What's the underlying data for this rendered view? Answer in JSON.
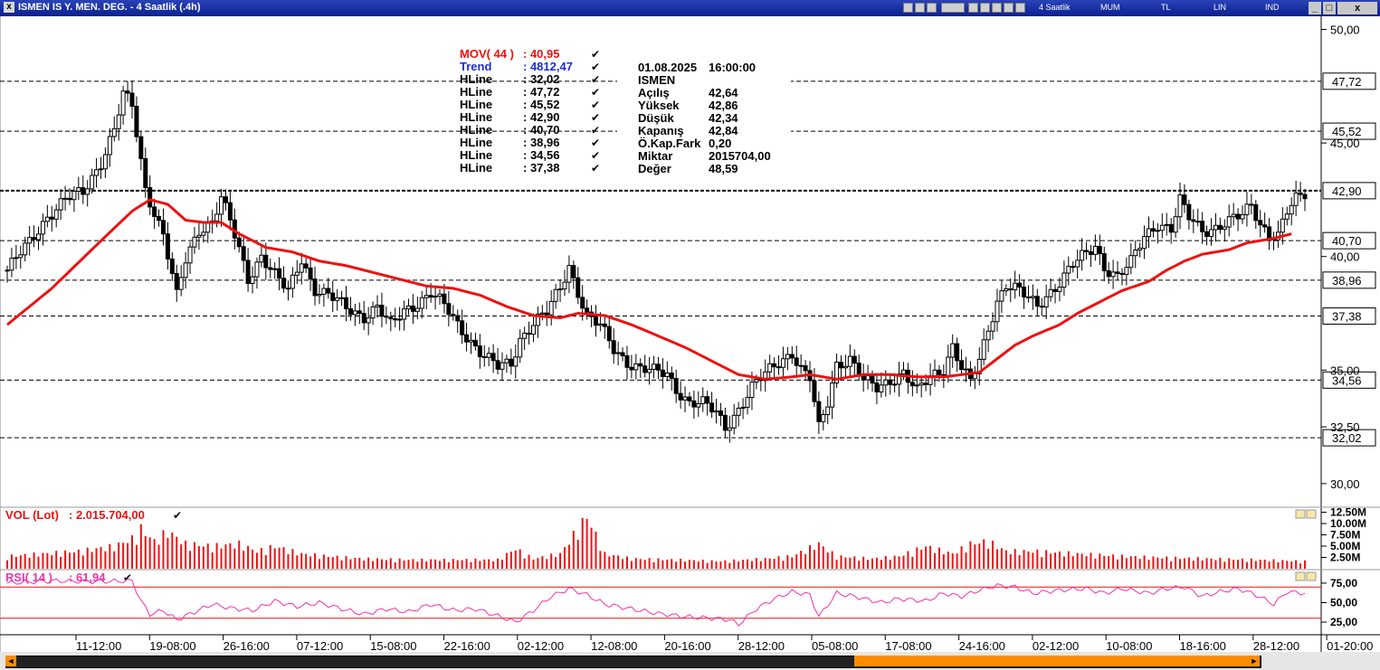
{
  "window": {
    "title": "ISMEN IS Y. MEN. DEG. - 4 Saatlik (.4h)",
    "toolbar_items": [
      "4 Saatlik",
      "MUM",
      "TL",
      "LIN",
      "IND"
    ],
    "close_glyph": "x"
  },
  "colors": {
    "mov": "#ee1111",
    "trend": "#1a2fd8",
    "vol": "#ee1111",
    "rsi": "#ee33aa",
    "rsi_band": "#ee1111",
    "candle": "#000000",
    "scroll_thumb": "#ff8c00"
  },
  "legend": {
    "indicators": [
      {
        "label": "MOV( 44 )",
        "value": ": 40,95",
        "color": "#ee1111"
      },
      {
        "label": "Trend",
        "value": ": 4812,47",
        "color": "#1a2fd8"
      },
      {
        "label": "HLine",
        "value": ": 32,02",
        "color": "#000000"
      },
      {
        "label": "HLine",
        "value": ": 47,72",
        "color": "#000000"
      },
      {
        "label": "HLine",
        "value": ": 45,52",
        "color": "#000000"
      },
      {
        "label": "HLine",
        "value": ": 42,90",
        "color": "#000000"
      },
      {
        "label": "HLine",
        "value": ": 40,70",
        "color": "#000000"
      },
      {
        "label": "HLine",
        "value": ": 38,96",
        "color": "#000000"
      },
      {
        "label": "HLine",
        "value": ": 34,56",
        "color": "#000000"
      },
      {
        "label": "HLine",
        "value": ": 37,38",
        "color": "#000000"
      }
    ],
    "check_glyph": "✔"
  },
  "info_box": {
    "datetime": [
      "01.08.2025",
      "16:00:00"
    ],
    "symbol": "ISMEN",
    "rows": [
      {
        "k": "Açılış",
        "v": "42,64"
      },
      {
        "k": "Yüksek",
        "v": "42,86"
      },
      {
        "k": "Düşük",
        "v": "42,34"
      },
      {
        "k": "Kapanış",
        "v": "42,84"
      },
      {
        "k": "Ö.Kap.Fark",
        "v": "0,20"
      },
      {
        "k": "Miktar",
        "v": "2015704,00"
      },
      {
        "k": "Değer",
        "v": "48,59"
      }
    ]
  },
  "vol_panel": {
    "label": "VOL (Lot)",
    "value": ": 2.015.704,00",
    "ticks": [
      "12.50M",
      "10.00M",
      "7.50M",
      "5.00M",
      "2.50M"
    ]
  },
  "rsi_panel": {
    "label": "RSI( 14 )",
    "value": ": 61,94",
    "ticks": [
      "75,00",
      "50,00",
      "25,00"
    ],
    "bands": [
      70,
      30
    ]
  },
  "chart_data": {
    "type": "candlestick",
    "price_axis": {
      "min": 29.0,
      "max": 50.5,
      "ticks": [
        "50,00",
        "45,00",
        "40,00",
        "35,00",
        "32,50",
        "30,00"
      ]
    },
    "hlines": [
      {
        "value": 47.72,
        "label": "47,72"
      },
      {
        "value": 45.52,
        "label": "45,52"
      },
      {
        "value": 42.9,
        "label": "42,90"
      },
      {
        "value": 40.7,
        "label": "40,70"
      },
      {
        "value": 38.96,
        "label": "38,96"
      },
      {
        "value": 37.38,
        "label": "37,38"
      },
      {
        "value": 34.56,
        "label": "34,56"
      },
      {
        "value": 32.02,
        "label": "32,02"
      }
    ],
    "x_labels": [
      "11-12:00",
      "19-08:00",
      "26-16:00",
      "07-12:00",
      "15-08:00",
      "22-16:00",
      "02-12:00",
      "12-08:00",
      "20-16:00",
      "28-12:00",
      "05-08:00",
      "17-08:00",
      "24-16:00",
      "02-12:00",
      "10-08:00",
      "18-16:00",
      "28-12:00",
      "01-20:00"
    ],
    "close_path": [
      [
        0,
        39.4
      ],
      [
        5,
        40.6
      ],
      [
        9,
        41.8
      ],
      [
        13,
        42.5
      ],
      [
        17,
        42.8
      ],
      [
        21,
        44.2
      ],
      [
        24,
        45.6
      ],
      [
        26,
        47.1
      ],
      [
        28,
        46.6
      ],
      [
        31,
        43.0
      ],
      [
        35,
        41.0
      ],
      [
        38,
        38.2
      ],
      [
        40,
        39.8
      ],
      [
        43,
        41.2
      ],
      [
        46,
        41.6
      ],
      [
        48,
        42.6
      ],
      [
        50,
        41.5
      ],
      [
        54,
        39.0
      ],
      [
        57,
        40.1
      ],
      [
        60,
        39.2
      ],
      [
        63,
        38.4
      ],
      [
        66,
        39.9
      ],
      [
        69,
        38.6
      ],
      [
        72,
        38.3
      ],
      [
        76,
        37.7
      ],
      [
        80,
        37.4
      ],
      [
        83,
        37.8
      ],
      [
        86,
        36.9
      ],
      [
        89,
        37.6
      ],
      [
        92,
        38.0
      ],
      [
        95,
        38.4
      ],
      [
        98,
        37.8
      ],
      [
        101,
        37.0
      ],
      [
        104,
        36.3
      ],
      [
        107,
        35.6
      ],
      [
        110,
        35.1
      ],
      [
        113,
        35.3
      ],
      [
        115,
        36.4
      ],
      [
        118,
        37.1
      ],
      [
        121,
        37.5
      ],
      [
        124,
        38.6
      ],
      [
        126,
        39.6
      ],
      [
        128,
        38.5
      ],
      [
        130,
        37.4
      ],
      [
        133,
        36.9
      ],
      [
        136,
        35.9
      ],
      [
        139,
        35.4
      ],
      [
        142,
        35.1
      ],
      [
        145,
        34.9
      ],
      [
        148,
        34.8
      ],
      [
        150,
        34.2
      ],
      [
        153,
        33.6
      ],
      [
        156,
        33.5
      ],
      [
        159,
        33.1
      ],
      [
        161,
        32.5
      ],
      [
        164,
        33.3
      ],
      [
        167,
        34.2
      ],
      [
        170,
        34.8
      ],
      [
        173,
        35.4
      ],
      [
        176,
        35.8
      ],
      [
        178,
        35.0
      ],
      [
        180,
        34.6
      ],
      [
        182,
        32.4
      ],
      [
        184,
        33.6
      ],
      [
        186,
        35.3
      ],
      [
        189,
        35.5
      ],
      [
        192,
        34.5
      ],
      [
        195,
        34.2
      ],
      [
        198,
        34.6
      ],
      [
        201,
        34.9
      ],
      [
        204,
        34.0
      ],
      [
        207,
        34.7
      ],
      [
        210,
        35.1
      ],
      [
        212,
        36.1
      ],
      [
        214,
        35.1
      ],
      [
        216,
        34.4
      ],
      [
        218,
        35.4
      ],
      [
        220,
        36.8
      ],
      [
        222,
        38.1
      ],
      [
        224,
        38.8
      ],
      [
        226,
        38.6
      ],
      [
        229,
        38.1
      ],
      [
        231,
        37.8
      ],
      [
        233,
        38.3
      ],
      [
        236,
        38.9
      ],
      [
        239,
        39.6
      ],
      [
        242,
        40.1
      ],
      [
        244,
        40.5
      ],
      [
        246,
        39.6
      ],
      [
        249,
        39.1
      ],
      [
        252,
        39.7
      ],
      [
        255,
        40.9
      ],
      [
        258,
        41.5
      ],
      [
        261,
        41.2
      ],
      [
        263,
        42.4
      ],
      [
        265,
        41.7
      ],
      [
        268,
        41.2
      ],
      [
        271,
        41.3
      ],
      [
        274,
        41.5
      ],
      [
        277,
        41.8
      ],
      [
        279,
        42.3
      ],
      [
        281,
        41.5
      ],
      [
        283,
        41.0
      ],
      [
        285,
        40.9
      ],
      [
        287,
        41.9
      ],
      [
        289,
        42.5
      ],
      [
        291,
        42.8
      ]
    ],
    "mov44_path": [
      [
        0,
        37.0
      ],
      [
        10,
        38.6
      ],
      [
        20,
        40.5
      ],
      [
        28,
        42.0
      ],
      [
        32,
        42.5
      ],
      [
        36,
        42.3
      ],
      [
        40,
        41.6
      ],
      [
        44,
        41.5
      ],
      [
        48,
        41.5
      ],
      [
        52,
        41.0
      ],
      [
        58,
        40.4
      ],
      [
        64,
        40.2
      ],
      [
        70,
        39.8
      ],
      [
        76,
        39.6
      ],
      [
        82,
        39.3
      ],
      [
        88,
        39.0
      ],
      [
        94,
        38.7
      ],
      [
        100,
        38.6
      ],
      [
        106,
        38.3
      ],
      [
        112,
        37.8
      ],
      [
        118,
        37.4
      ],
      [
        124,
        37.3
      ],
      [
        128,
        37.5
      ],
      [
        134,
        37.4
      ],
      [
        140,
        37.0
      ],
      [
        146,
        36.5
      ],
      [
        152,
        36.0
      ],
      [
        158,
        35.4
      ],
      [
        164,
        34.8
      ],
      [
        170,
        34.6
      ],
      [
        176,
        34.7
      ],
      [
        180,
        34.8
      ],
      [
        186,
        34.6
      ],
      [
        192,
        34.8
      ],
      [
        198,
        34.8
      ],
      [
        204,
        34.7
      ],
      [
        210,
        34.7
      ],
      [
        214,
        34.8
      ],
      [
        218,
        34.9
      ],
      [
        222,
        35.5
      ],
      [
        226,
        36.1
      ],
      [
        230,
        36.5
      ],
      [
        236,
        37.0
      ],
      [
        240,
        37.5
      ],
      [
        246,
        38.1
      ],
      [
        250,
        38.5
      ],
      [
        256,
        38.9
      ],
      [
        260,
        39.4
      ],
      [
        264,
        39.8
      ],
      [
        268,
        40.1
      ],
      [
        274,
        40.3
      ],
      [
        278,
        40.6
      ],
      [
        284,
        40.8
      ],
      [
        288,
        41.0
      ]
    ],
    "volume_path": [
      [
        0,
        2.5
      ],
      [
        8,
        3.0
      ],
      [
        16,
        3.5
      ],
      [
        24,
        4.5
      ],
      [
        28,
        6.0
      ],
      [
        30,
        8.0
      ],
      [
        33,
        5.5
      ],
      [
        36,
        7.5
      ],
      [
        40,
        5.0
      ],
      [
        46,
        4.5
      ],
      [
        52,
        5.0
      ],
      [
        56,
        3.5
      ],
      [
        60,
        4.5
      ],
      [
        66,
        3.0
      ],
      [
        72,
        2.5
      ],
      [
        80,
        2.0
      ],
      [
        90,
        1.8
      ],
      [
        100,
        1.8
      ],
      [
        110,
        1.8
      ],
      [
        114,
        4.0
      ],
      [
        118,
        2.0
      ],
      [
        124,
        3.0
      ],
      [
        128,
        8.0
      ],
      [
        130,
        10.5
      ],
      [
        134,
        3.0
      ],
      [
        140,
        2.0
      ],
      [
        150,
        1.8
      ],
      [
        160,
        1.5
      ],
      [
        170,
        2.0
      ],
      [
        176,
        2.5
      ],
      [
        182,
        5.0
      ],
      [
        186,
        2.5
      ],
      [
        194,
        2.0
      ],
      [
        200,
        2.5
      ],
      [
        206,
        4.5
      ],
      [
        212,
        3.0
      ],
      [
        216,
        5.0
      ],
      [
        220,
        5.5
      ],
      [
        224,
        3.5
      ],
      [
        230,
        3.5
      ],
      [
        240,
        3.0
      ],
      [
        250,
        2.5
      ],
      [
        260,
        2.2
      ],
      [
        270,
        2.0
      ],
      [
        280,
        1.8
      ],
      [
        291,
        1.5
      ]
    ],
    "rsi_path": [
      [
        0,
        75.0
      ],
      [
        10,
        78.0
      ],
      [
        20,
        77.0
      ],
      [
        28,
        78.0
      ],
      [
        30,
        52.0
      ],
      [
        32,
        35.0
      ],
      [
        35,
        40.0
      ],
      [
        38,
        28.0
      ],
      [
        42,
        38.0
      ],
      [
        46,
        48.0
      ],
      [
        50,
        43.0
      ],
      [
        55,
        40.0
      ],
      [
        60,
        52.0
      ],
      [
        65,
        45.0
      ],
      [
        70,
        50.0
      ],
      [
        75,
        42.0
      ],
      [
        80,
        35.0
      ],
      [
        85,
        42.0
      ],
      [
        90,
        38.0
      ],
      [
        95,
        48.0
      ],
      [
        100,
        40.0
      ],
      [
        105,
        42.0
      ],
      [
        110,
        33.0
      ],
      [
        114,
        25.0
      ],
      [
        118,
        40.0
      ],
      [
        122,
        58.0
      ],
      [
        126,
        68.0
      ],
      [
        130,
        60.0
      ],
      [
        134,
        48.0
      ],
      [
        140,
        42.0
      ],
      [
        146,
        36.0
      ],
      [
        152,
        32.0
      ],
      [
        158,
        30.0
      ],
      [
        162,
        28.0
      ],
      [
        164,
        22.0
      ],
      [
        168,
        42.0
      ],
      [
        172,
        55.0
      ],
      [
        176,
        64.0
      ],
      [
        180,
        60.0
      ],
      [
        182,
        32.0
      ],
      [
        186,
        62.0
      ],
      [
        190,
        58.0
      ],
      [
        196,
        50.0
      ],
      [
        200,
        55.0
      ],
      [
        206,
        52.0
      ],
      [
        210,
        62.0
      ],
      [
        214,
        58.0
      ],
      [
        218,
        66.0
      ],
      [
        222,
        72.0
      ],
      [
        226,
        70.0
      ],
      [
        230,
        62.0
      ],
      [
        236,
        66.0
      ],
      [
        242,
        68.0
      ],
      [
        246,
        62.0
      ],
      [
        250,
        68.0
      ],
      [
        256,
        62.0
      ],
      [
        260,
        68.0
      ],
      [
        264,
        70.0
      ],
      [
        268,
        58.0
      ],
      [
        272,
        64.0
      ],
      [
        276,
        68.0
      ],
      [
        280,
        60.0
      ],
      [
        284,
        48.0
      ],
      [
        287,
        64.0
      ],
      [
        291,
        62.0
      ]
    ]
  }
}
